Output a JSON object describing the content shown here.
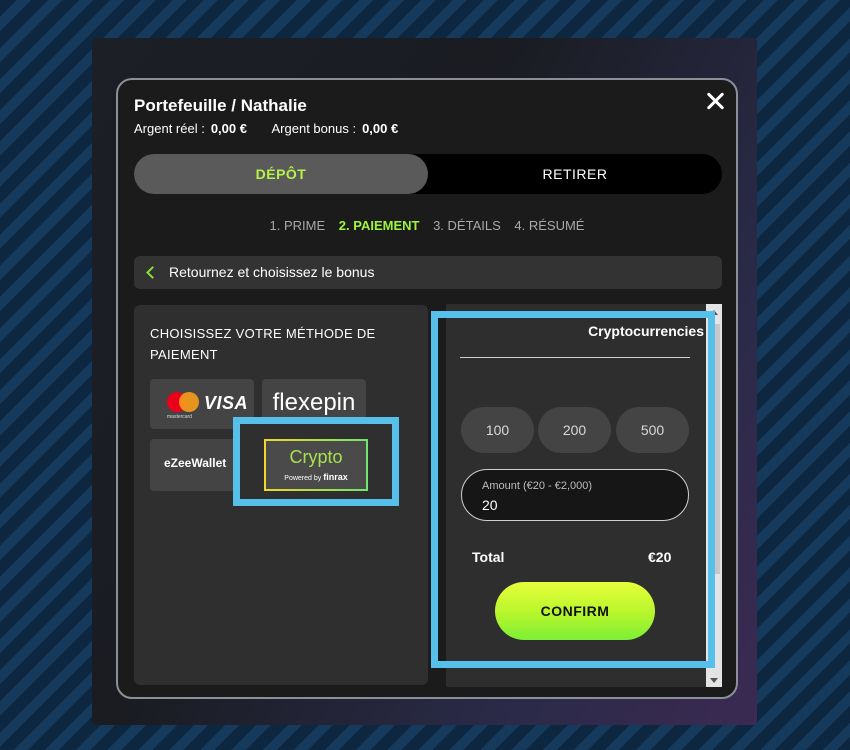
{
  "modal": {
    "title": "Portefeuille / Nathalie",
    "real_money_label": "Argent réel :",
    "real_money_value": "0,00 €",
    "bonus_money_label": "Argent bonus :",
    "bonus_money_value": "0,00 €"
  },
  "tabs": {
    "deposit": "DÉPÔT",
    "withdraw": "RETIRER"
  },
  "steps": [
    "1. PRIME",
    "2. PAIEMENT",
    "3. DÉTAILS",
    "4. RÉSUMÉ"
  ],
  "back": {
    "label": "Retournez et choisissez le bonus"
  },
  "payment_methods": {
    "title": "CHOISISSEZ VOTRE MÉTHODE DE PAIEMENT",
    "mastercard_text": "mastercard",
    "visa": "VISA",
    "flexepin": "flexepin",
    "ezeewallet": "eZeeWallet",
    "crypto": "Crypto",
    "crypto_powered": "Powered by",
    "crypto_provider": "finrax"
  },
  "crypto_panel": {
    "title": "Cryptocurrencies",
    "amount_options": [
      "100",
      "200",
      "500"
    ],
    "amount_placeholder": "Amount (€20 - €2,000)",
    "amount_value": "20",
    "total_label": "Total",
    "total_value": "€20",
    "confirm_label": "CONFIRM"
  },
  "colors": {
    "accent_green": "#9ff53a",
    "highlight_blue": "#56c0ea"
  }
}
